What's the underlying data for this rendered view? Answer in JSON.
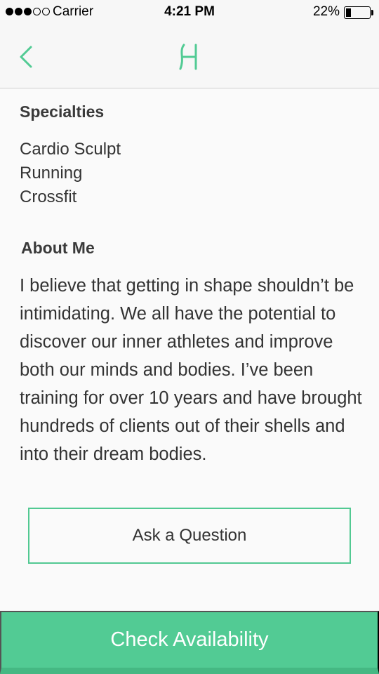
{
  "status_bar": {
    "signal_bars_filled": 3,
    "signal_bars_total": 5,
    "carrier": "Carrier",
    "time": "4:21 PM",
    "battery_percent": "22%",
    "battery_level": 0.22
  },
  "nav": {
    "back_icon": "chevron-left-icon",
    "logo_icon": "brand-logo-icon"
  },
  "specialties": {
    "title": "Specialties",
    "items": [
      "Cardio Sculpt",
      "Running",
      "Crossfit"
    ]
  },
  "about": {
    "title": "About Me",
    "text": "I believe that getting in shape shouldn’t be intimidating. We all have the potential to discover our inner athletes and improve both our minds and bodies. I’ve been training for over 10 years and have brought hundreds of clients out of their shells and into their dream bodies."
  },
  "actions": {
    "ask_label": "Ask a Question",
    "check_label": "Check Availability"
  },
  "colors": {
    "accent": "#52cb94",
    "background": "#fafafa",
    "bar": "#f7f7f7"
  }
}
